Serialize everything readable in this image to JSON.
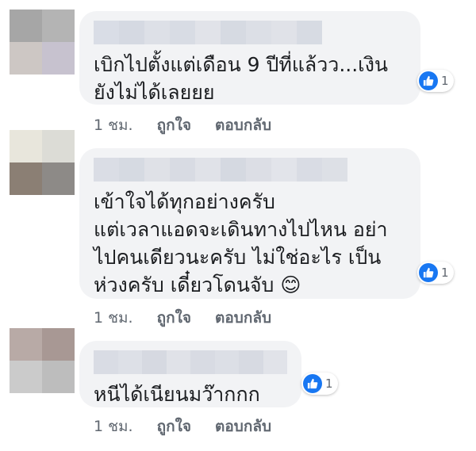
{
  "comments": [
    {
      "avatar_colors": [
        "#a6a6a6",
        "#b4b4b4",
        "#cdc7c4",
        "#c7c2cf"
      ],
      "name_blur_colors": [
        "#d9dde6",
        "#d5d9e2",
        "#dde0e7",
        "#d8dce4",
        "#e1e3e9",
        "#d6dae2",
        "#dcdfe6",
        "#e0e2e8",
        "#d7dbe3"
      ],
      "text": "เบิกไปตั้งแต่เดือน 9 ปีที่แล้วว...เงิน\nยังไม่ได้เลยยย",
      "reaction_count": "1",
      "time": "1 ชม.",
      "like_label": "ถูกใจ",
      "reply_label": "ตอบกลับ"
    },
    {
      "avatar_colors": [
        "#e8e6dc",
        "#dcdcd6",
        "#8b7f74",
        "#8d8a87"
      ],
      "name_blur_colors": [
        "#dadde5",
        "#d6dae2",
        "#dfe1e7",
        "#d8dbe3",
        "#e0e2e8",
        "#d5d9e1",
        "#dcdee5",
        "#e2e4ea",
        "#d9dce4",
        "#dde0e6"
      ],
      "text": "เข้าใจได้ทุกอย่างครับ\nแต่เวลาแอดจะเดินทางไปไหน อย่า\nไปคนเดียวนะครับ ไม่ใช่อะไร เป็น\nห่วงครับ เดี๋ยวโดนจับ 😊",
      "reaction_count": "1",
      "time": "1 ชม.",
      "like_label": "ถูกใจ",
      "reply_label": "ตอบกลับ"
    },
    {
      "avatar_colors": [
        "#b8aaa6",
        "#a89894",
        "#cbcbcb",
        "#bdbdbd"
      ],
      "name_blur_colors": [
        "#d9dce4",
        "#dde0e7",
        "#d6d9e1",
        "#e0e2e8",
        "#d8dbe3",
        "#dcdfe6",
        "#d7dae2",
        "#e1e3e9"
      ],
      "text": "หนีได้เนียนมว๊ากกก",
      "reaction_count": "1",
      "time": "1 ชม.",
      "like_label": "ถูกใจ",
      "reply_label": "ตอบกลับ"
    }
  ],
  "colors": {
    "bubble": "#f2f3f5",
    "like_blue": "#1877f2",
    "meta_text": "#606770"
  }
}
